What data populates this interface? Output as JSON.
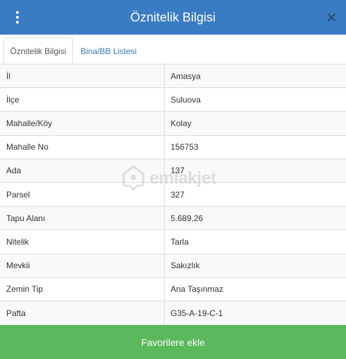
{
  "header": {
    "title": "Öznitelik Bilgisi",
    "menu_icon": "vertical-ellipsis-icon",
    "close_icon": "close-icon",
    "background": "#3a7cc3"
  },
  "tabs": [
    {
      "label": "Öznitelik Bilgisi",
      "active": true
    },
    {
      "label": "Bina/BB Listesi",
      "active": false
    }
  ],
  "attributes": [
    {
      "key": "İl",
      "value": "Amasya"
    },
    {
      "key": "İlçe",
      "value": "Suluova"
    },
    {
      "key": "Mahalle/Köy",
      "value": "Kolay"
    },
    {
      "key": "Mahalle No",
      "value": "156753"
    },
    {
      "key": "Ada",
      "value": "137"
    },
    {
      "key": "Parsel",
      "value": "327"
    },
    {
      "key": "Tapu Alanı",
      "value": "5.689,26"
    },
    {
      "key": "Nitelik",
      "value": "Tarla"
    },
    {
      "key": "Mevkii",
      "value": "Sakızlık"
    },
    {
      "key": "Zemin Tip",
      "value": "Ana Taşınmaz"
    },
    {
      "key": "Pafta",
      "value": "G35-A-19-C-1"
    }
  ],
  "watermark": {
    "text": "emlakjet",
    "icon": "house-pin-icon"
  },
  "footer": {
    "favorite_label": "Favorilere ekle",
    "color": "#5cb85c"
  }
}
